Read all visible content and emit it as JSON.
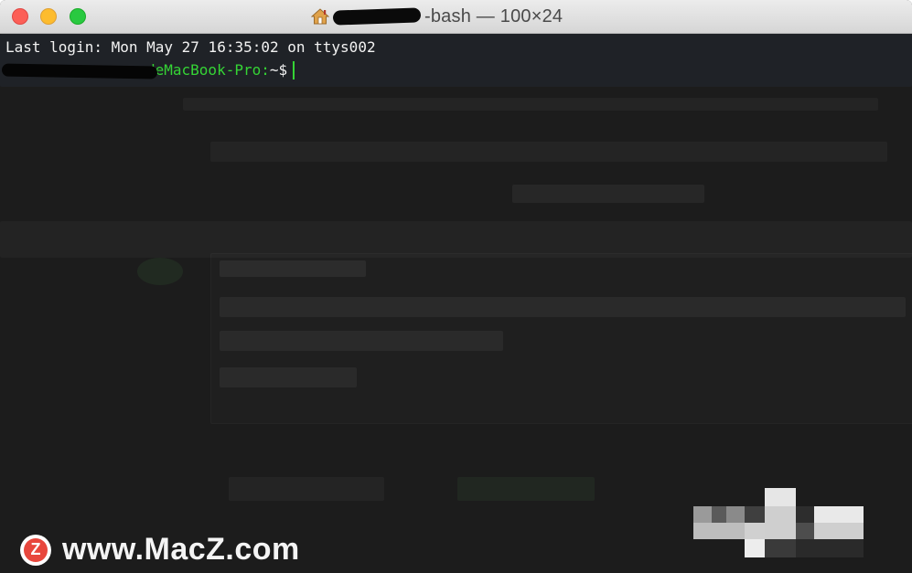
{
  "window": {
    "title": "-bash — 100×24",
    "title_icon": "home-icon"
  },
  "terminal": {
    "last_login": "Last login: Mon May 27 16:35:02 on ttys002",
    "prompt_host": "deMacBook-Pro:",
    "prompt_path": "~$"
  },
  "colors": {
    "prompt_green": "#35d435",
    "terminal_bg": "#1c1c1c",
    "title_text": "#4a4a4a"
  },
  "watermark": {
    "logo_letter": "Z",
    "text": "www.MacZ.com"
  }
}
